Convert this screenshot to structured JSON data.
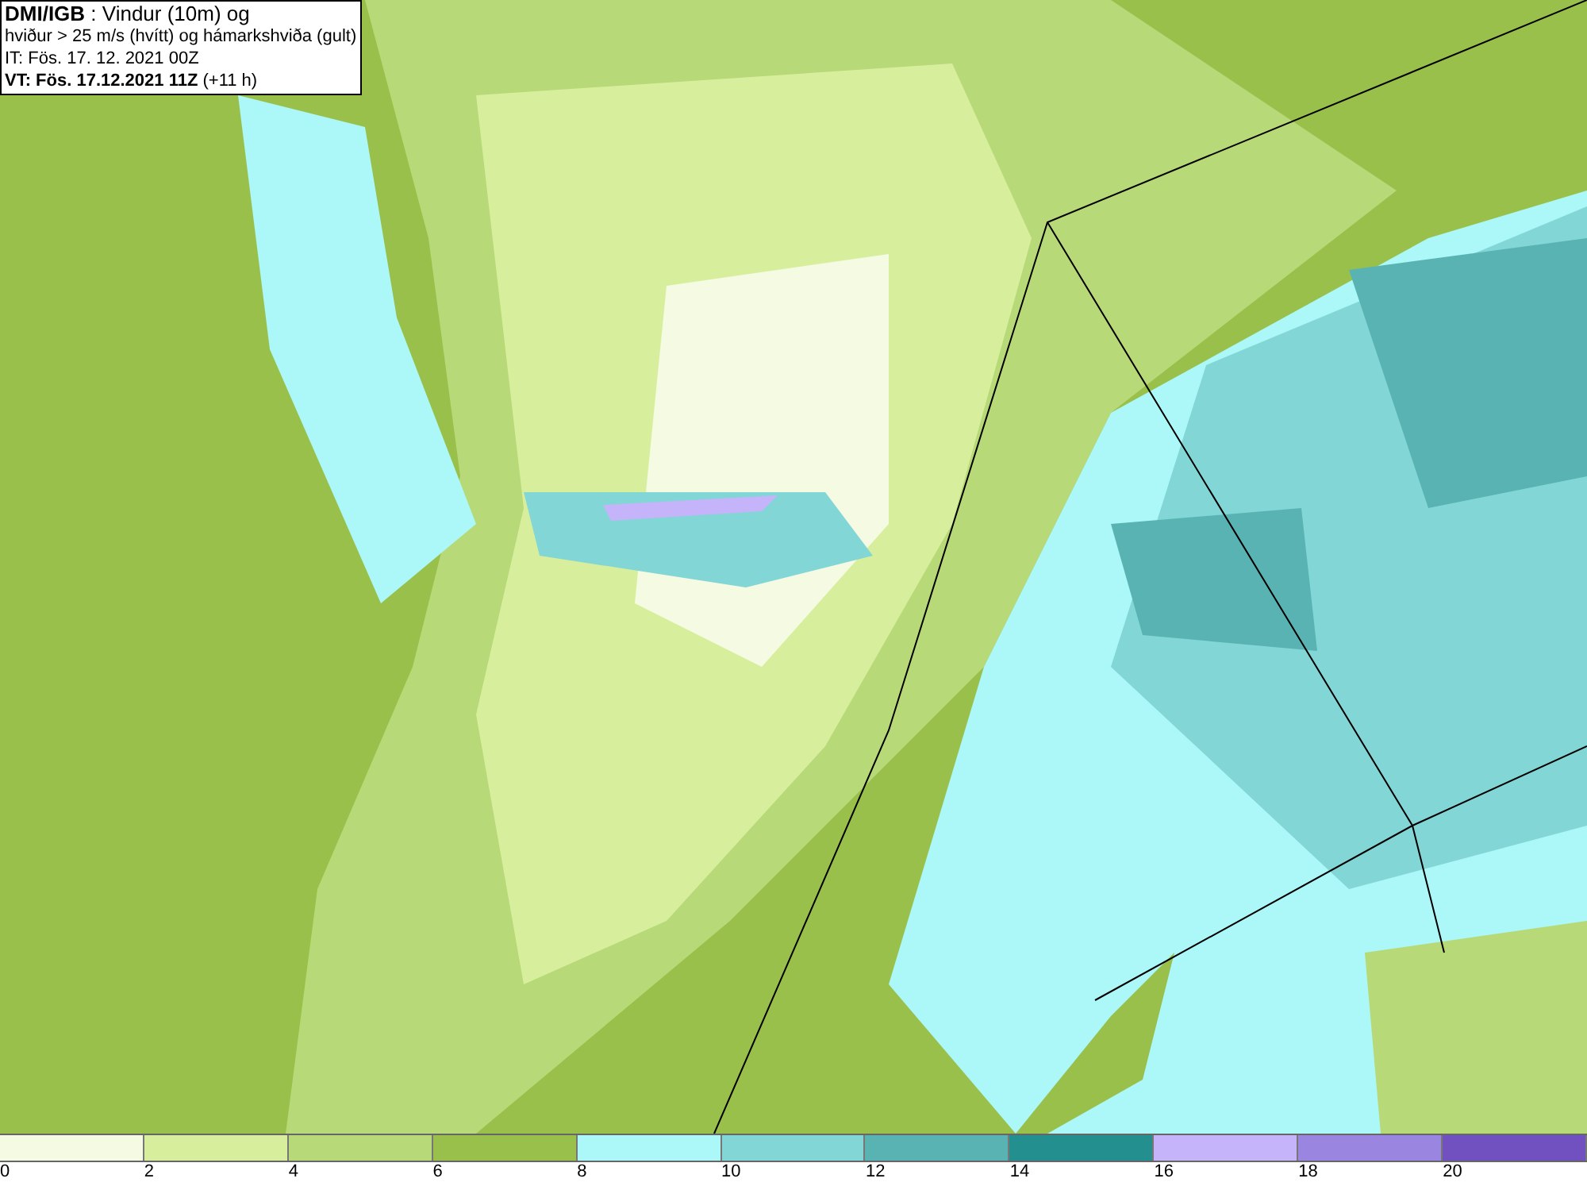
{
  "title_box": {
    "lines": [
      "**DMI/IGB** : Vindur (10m) og",
      "hviður > 25 m/s (hvítt) og hámarkshviða (gult)",
      "IT: Fös. 17. 12. 2021 00Z",
      "**VT: Fös. 17.12.2021 11Z** (+11 h)"
    ]
  },
  "legend": {
    "segments": [
      {
        "color": "#f5fae2"
      },
      {
        "color": "#d7ef9c"
      },
      {
        "color": "#b8d978"
      },
      {
        "color": "#99c04a"
      },
      {
        "color": "#acf7f7"
      },
      {
        "color": "#82d6d6"
      },
      {
        "color": "#59b3b3"
      },
      {
        "color": "#248f8f"
      },
      {
        "color": "#c5b4fa"
      },
      {
        "color": "#9a85e0"
      },
      {
        "color": "#7150c0"
      }
    ],
    "labels": [
      "0",
      "2",
      "4",
      "6",
      "8",
      "10",
      "12",
      "14",
      "16",
      "18",
      "20"
    ]
  }
}
